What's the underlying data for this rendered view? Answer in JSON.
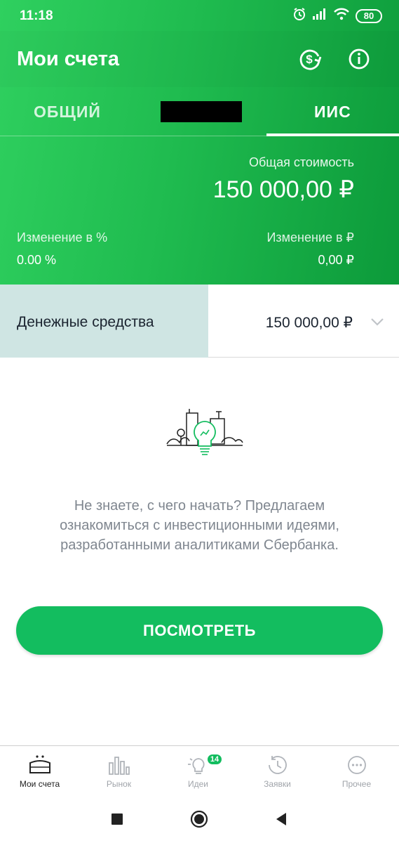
{
  "status_bar": {
    "time": "11:18",
    "battery": "80",
    "icons": [
      "alarm-icon",
      "signal-icon",
      "wifi-icon",
      "battery-icon"
    ]
  },
  "header": {
    "title": "Мои счета",
    "icons": [
      "currency-exchange-icon",
      "info-icon"
    ]
  },
  "tabs": [
    {
      "label": "ОБЩИЙ",
      "active": false
    },
    {
      "label": "ИИС",
      "active": true
    }
  ],
  "summary": {
    "total_label": "Общая стоимость",
    "total_value": "150 000,00 ₽",
    "change_percent_label": "Изменение в  %",
    "change_percent_value": "0.00  %",
    "change_rub_label": "Изменение в ₽",
    "change_rub_value": "0,00 ₽"
  },
  "cash": {
    "label": "Денежные средства",
    "value": "150 000,00 ₽"
  },
  "promo": {
    "text": "Не знаете, с чего начать? Предлагаем ознакомиться с инвестиционными идеями, разработанными аналитиками Сбербанка.",
    "button": "ПОСМОТРЕТЬ"
  },
  "bottom_nav": [
    {
      "label": "Мои счета",
      "icon": "wallet-icon",
      "active": true
    },
    {
      "label": "Рынок",
      "icon": "market-icon",
      "active": false
    },
    {
      "label": "Идеи",
      "icon": "lightbulb-icon",
      "active": false,
      "badge": "14"
    },
    {
      "label": "Заявки",
      "icon": "history-icon",
      "active": false
    },
    {
      "label": "Прочее",
      "icon": "more-icon",
      "active": false
    }
  ],
  "colors": {
    "accent": "#13bd5f",
    "header_gradient_start": "#2fd05f",
    "header_gradient_end": "#0c9a3a",
    "cash_panel": "#cfe5e3"
  }
}
